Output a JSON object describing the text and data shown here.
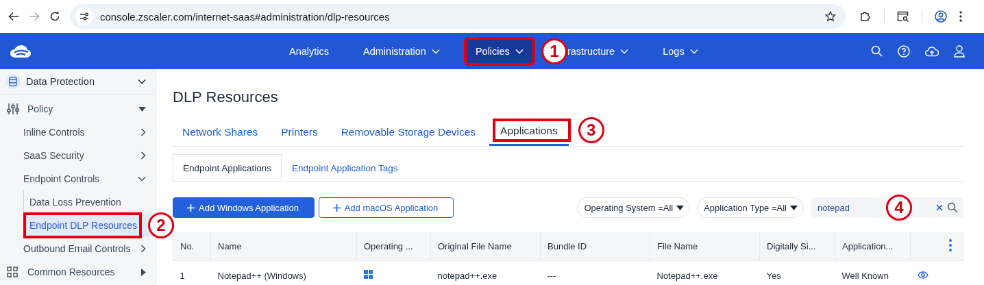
{
  "browser": {
    "url": "console.zscaler.com/internet-saas#administration/dlp-resources"
  },
  "navbar": {
    "items": [
      {
        "label": "Analytics",
        "dropdown": false,
        "selected": false
      },
      {
        "label": "Administration",
        "dropdown": true,
        "selected": false
      },
      {
        "label": "Policies",
        "dropdown": true,
        "selected": true,
        "annotation": "1"
      },
      {
        "label": "rastructure",
        "dropdown": true,
        "selected": false
      },
      {
        "label": "Logs",
        "dropdown": true,
        "selected": false
      }
    ]
  },
  "sidebar": {
    "items": [
      {
        "label": "Data Protection",
        "expanded": true
      },
      {
        "label": "Policy",
        "expanded": true,
        "children": [
          {
            "label": "Inline Controls",
            "expanded": false
          },
          {
            "label": "SaaS Security",
            "expanded": false
          },
          {
            "label": "Endpoint Controls",
            "expanded": true,
            "children": [
              {
                "label": "Data Loss Prevention",
                "selected": false
              },
              {
                "label": "Endpoint DLP Resources",
                "selected": true,
                "annotation": "2"
              }
            ]
          },
          {
            "label": "Outbound Email Controls",
            "expanded": false
          }
        ]
      },
      {
        "label": "Common Resources",
        "expanded": false
      }
    ]
  },
  "page_title": "DLP Resources",
  "tabs": [
    {
      "label": "Network Shares",
      "selected": false
    },
    {
      "label": "Printers",
      "selected": false
    },
    {
      "label": "Removable Storage Devices",
      "selected": false
    },
    {
      "label": "Applications",
      "selected": true,
      "annotation": "3"
    }
  ],
  "subtabs": [
    {
      "label": "Endpoint Applications",
      "selected": true
    },
    {
      "label": "Endpoint Application Tags",
      "selected": false
    }
  ],
  "buttons": [
    {
      "label": "Add Windows Application",
      "kind": "primary"
    },
    {
      "label": "Add macOS Application",
      "kind": "outline"
    }
  ],
  "filters": [
    {
      "label": "Operating System =All"
    },
    {
      "label": "Application Type =All"
    }
  ],
  "search": {
    "value": "notepad",
    "annotation": "4"
  },
  "table": {
    "columns": [
      "No.",
      "Name",
      "Operating ...",
      "Original File Name",
      "Bundle ID",
      "File Name",
      "Digitally Si...",
      "Application..."
    ],
    "rows": [
      {
        "no": "1",
        "name": "Notepad++ (Windows)",
        "kind": "windows",
        "original_file_name": "notepad++.exe",
        "bundle_id": "---",
        "file_name": "Notepad++.exe",
        "digitally_signed": "Yes",
        "application_type": "Well Known"
      }
    ]
  }
}
